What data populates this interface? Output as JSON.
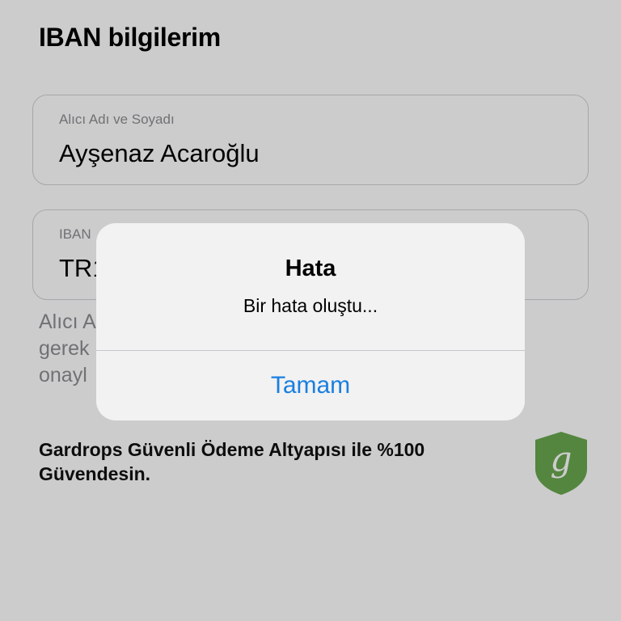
{
  "page": {
    "title": "IBAN bilgilerim"
  },
  "form": {
    "name_label": "Alıcı Adı ve Soyadı",
    "name_value": "Ayşenaz Acaroğlu",
    "iban_label": "IBAN",
    "iban_value": "TR1"
  },
  "info": {
    "lines": [
      "Alıcı A",
      "gerek",
      "onayl"
    ]
  },
  "security": {
    "text": "Gardrops Güvenli Ödeme Altyapısı ile %100 Güvendesin.",
    "logo_letter": "g",
    "logo_color": "#6aa84f"
  },
  "alert": {
    "title": "Hata",
    "message": "Bir hata oluştu...",
    "button_label": "Tamam",
    "button_color": "#1a7fe0"
  }
}
